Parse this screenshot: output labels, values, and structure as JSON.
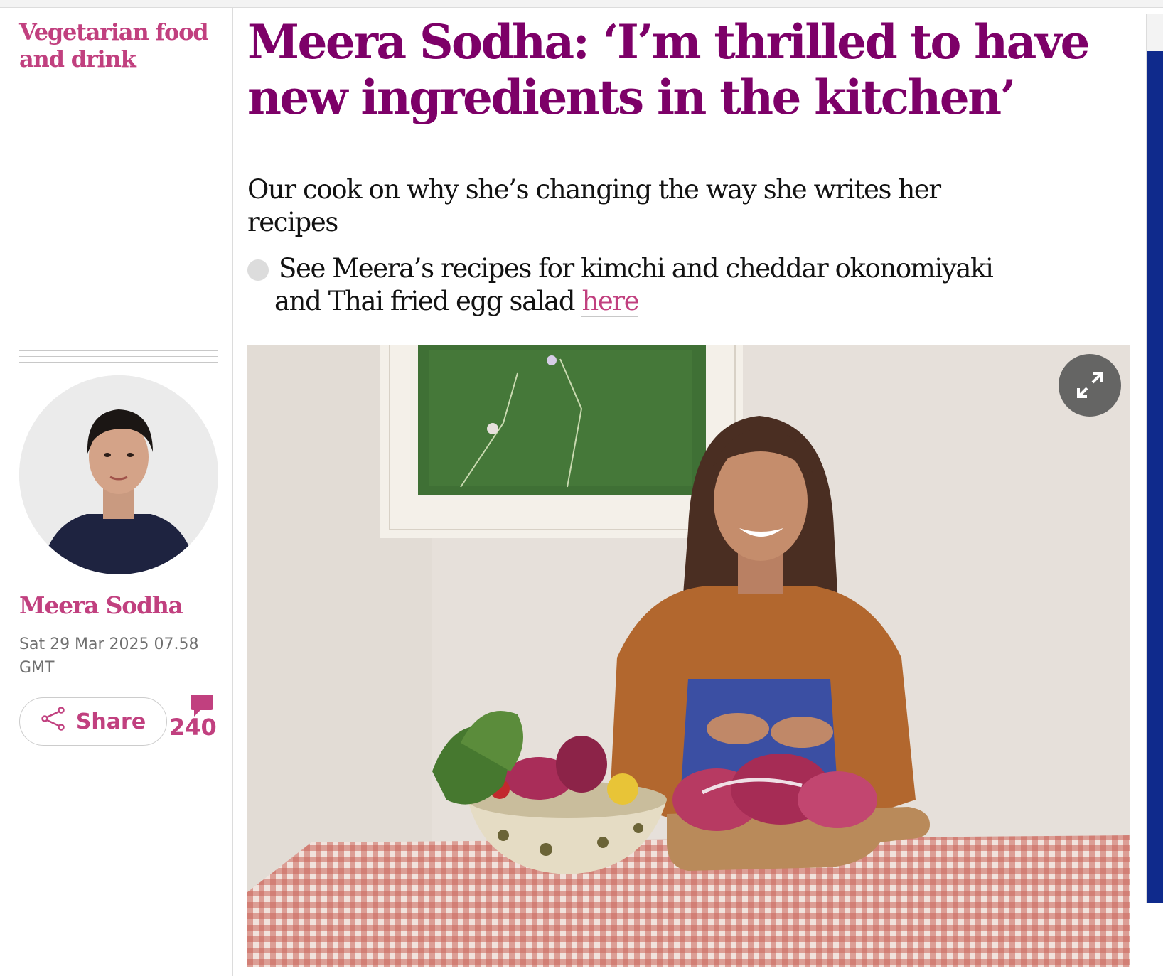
{
  "section": {
    "label": "Vegetarian food and drink"
  },
  "article": {
    "headline": "Meera Sodha: ‘I’m thrilled to have new ingredients in the kitchen’",
    "standfirst": "Our cook on why she’s changing the way she writes her recipes",
    "bullet": {
      "line1": "See Meera’s recipes for kimchi and cheddar okonomiyaki",
      "line2": "and Thai fried egg salad",
      "link_text": "here"
    }
  },
  "meta": {
    "author": "Meera Sodha",
    "date": "Sat 29 Mar 2025 07.58 GMT",
    "share_label": "Share",
    "comment_count": "240"
  },
  "icons": {
    "share": "share-icon",
    "comment": "comment-icon",
    "expand": "expand-icon"
  },
  "colors": {
    "headline": "#7d0068",
    "accent": "#c1407f",
    "text": "#121212",
    "muted": "#707070"
  }
}
